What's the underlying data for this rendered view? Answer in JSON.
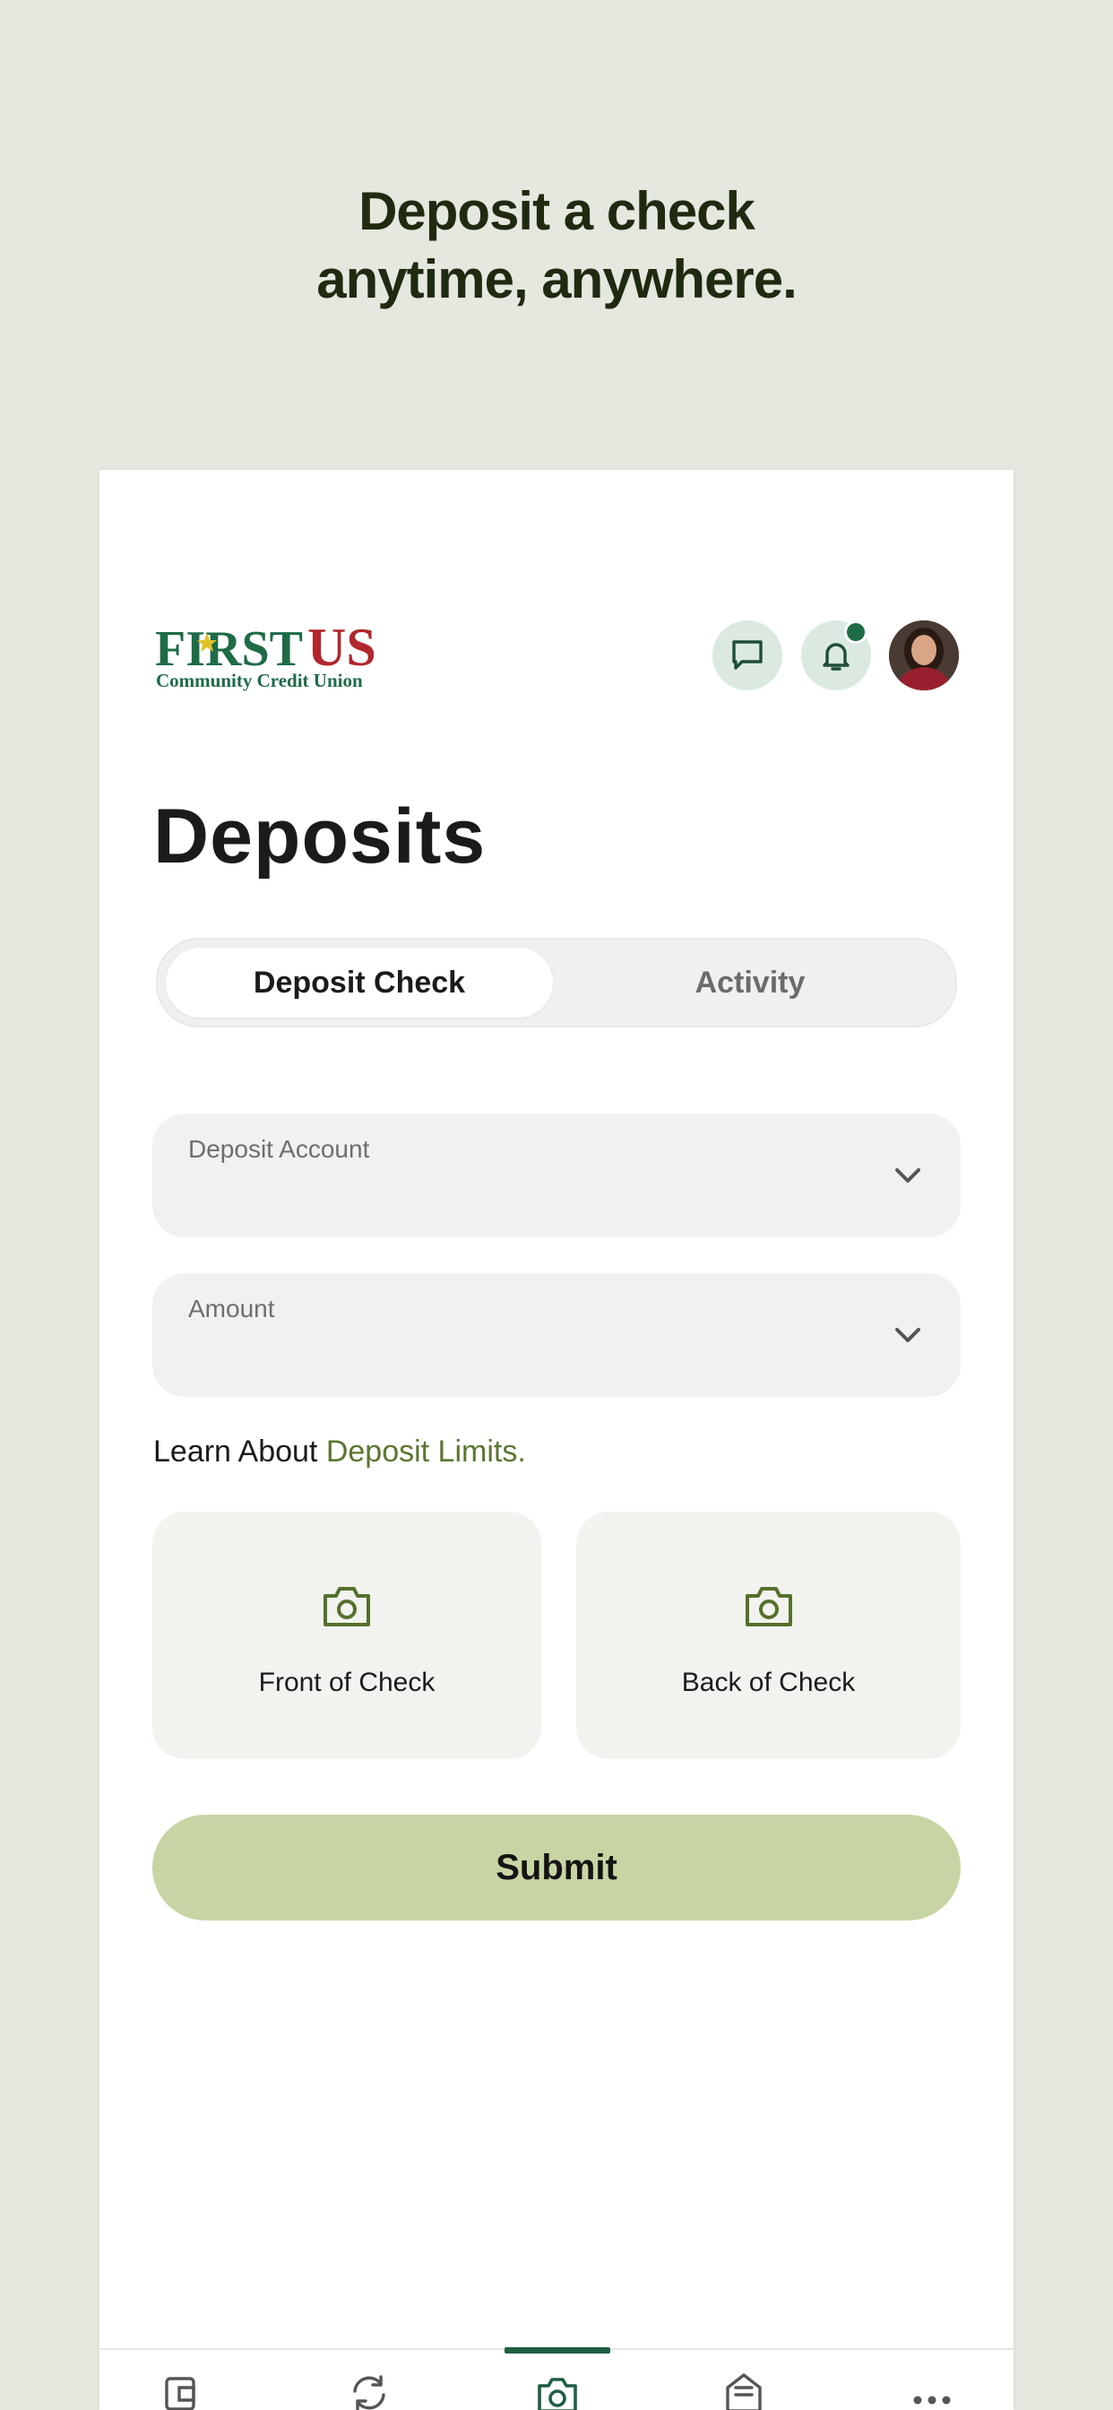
{
  "promo": {
    "headline_line1": "Deposit a check",
    "headline_line2": "anytime, anywhere."
  },
  "header": {
    "logo_text_first": "FIRST",
    "logo_text_us": "US",
    "logo_subtitle": "Community Credit Union",
    "icons": [
      "chat-icon",
      "bell-icon",
      "avatar"
    ],
    "has_notification": true
  },
  "page": {
    "title": "Deposits"
  },
  "tabs": {
    "active": "Deposit Check",
    "inactive": "Activity"
  },
  "form": {
    "account_label": "Deposit Account",
    "amount_label": "Amount",
    "learn_prefix": "Learn About ",
    "learn_link": "Deposit Limits.",
    "front_label": "Front of Check",
    "back_label": "Back of Check",
    "submit_label": "Submit"
  },
  "bottom_nav": {
    "items": [
      "wallet-icon",
      "transfer-icon",
      "camera-icon",
      "bill-icon",
      "more-icon"
    ],
    "active_index": 2
  },
  "colors": {
    "background": "#e5e8df",
    "brand_green": "#1e5e42",
    "logo_red": "#b0272d",
    "link_green": "#5b7630",
    "submit_bg": "#c7d5a4"
  }
}
